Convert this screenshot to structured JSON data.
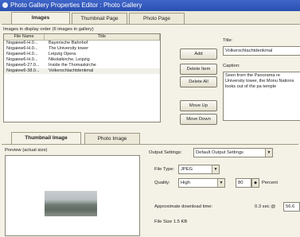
{
  "window": {
    "title": "Photo Gallery Properties Editor : Photo Gallery"
  },
  "tabs": [
    {
      "label": "Images"
    },
    {
      "label": "Thumbnail Page"
    },
    {
      "label": "Photo Page"
    }
  ],
  "images": {
    "list_label": "Images in display order (6 images in gallery)",
    "columns": [
      "File Name",
      "Title"
    ],
    "rows": [
      {
        "file": "Nogaiew6-H.0...",
        "title": "Bayerische Bahnhof"
      },
      {
        "file": "Nogaiew6-H.0...",
        "title": "The University tower"
      },
      {
        "file": "Nogaiew6-H.0...",
        "title": "Leipzig Opera"
      },
      {
        "file": "Nogaiew6-H.0...",
        "title": "Nikolaikirche, Leipzig"
      },
      {
        "file": "Nogaiew6-27.0...",
        "title": "Inside the Thomaskirche"
      },
      {
        "file": "Nogaiew6-38.0...",
        "title": "Volkerschlachtdenkmal"
      }
    ]
  },
  "buttons": {
    "add": "Add",
    "delete_item": "Delete Item",
    "delete_all": "Delete All",
    "move_up": "Move Up",
    "move_down": "Move Down"
  },
  "details": {
    "title_label": "Title:",
    "title_value": "Volkerschlachtdenkmal",
    "caption_label": "Caption:",
    "caption_value": "Seen from the Panorama re University tower, the Monu Nations looks out of the pa temple"
  },
  "lower_tabs": [
    {
      "label": "Thumbnail Image"
    },
    {
      "label": "Photo Image"
    }
  ],
  "preview_label": "Preview (actual size)",
  "output": {
    "settings_label": "Output Settings:",
    "settings_value": "Default Output Settings",
    "filetype_label": "File Type:",
    "filetype_value": "JPEG",
    "quality_label": "Quality:",
    "quality_value": "High",
    "quality_percent": "80",
    "percent_label": "Percent",
    "download_label": "Approximate download time:",
    "download_value": "0.3 sec @",
    "download_speed": "56.6",
    "filesize_label": "File Size 1.5 KB"
  }
}
